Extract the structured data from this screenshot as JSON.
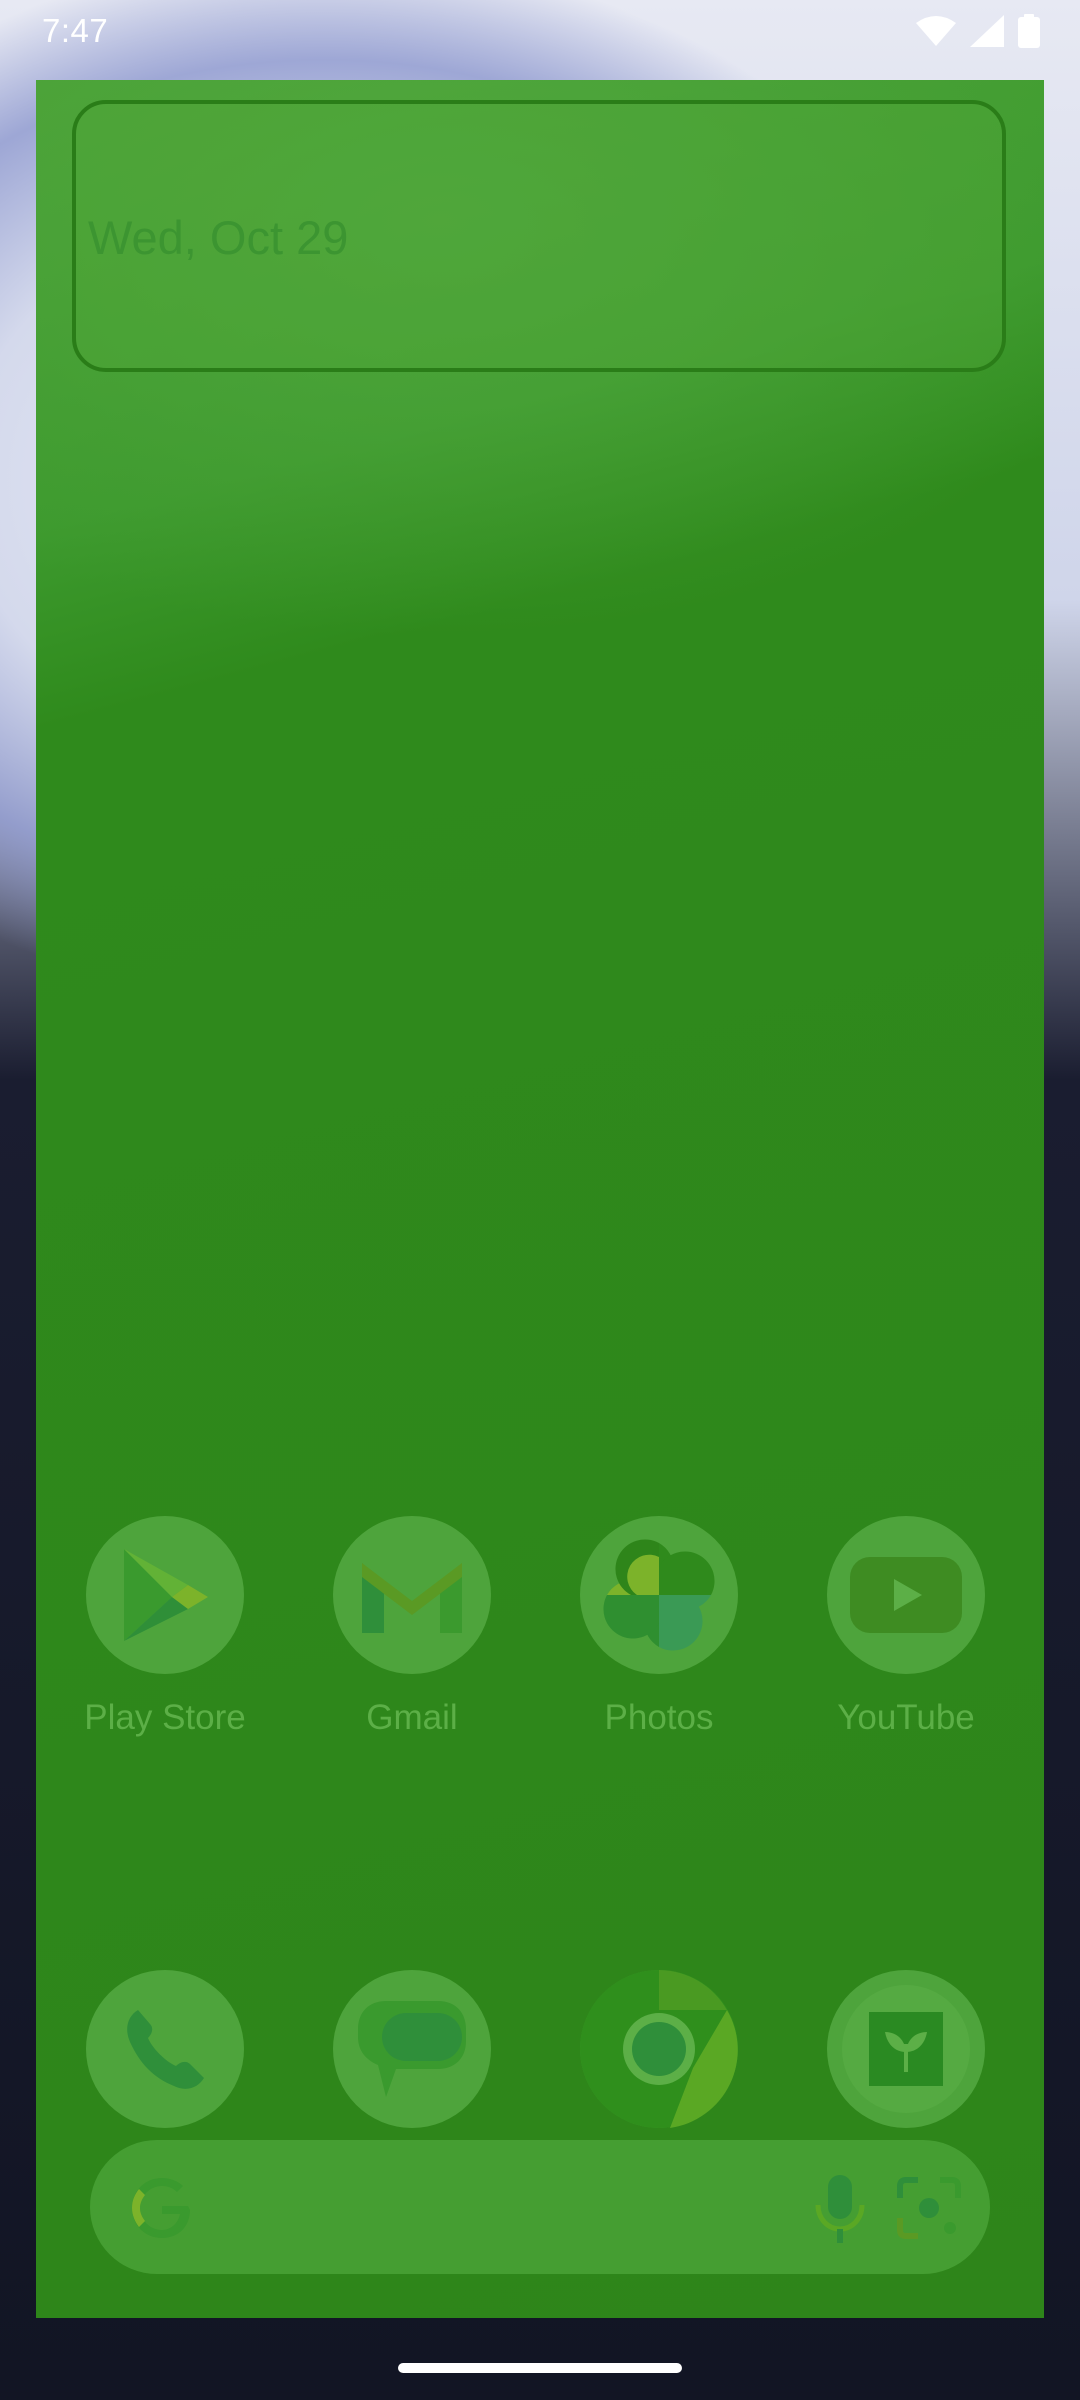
{
  "status_bar": {
    "time": "7:47",
    "icons": [
      "wifi-icon",
      "cellular-signal-icon",
      "battery-icon"
    ]
  },
  "home": {
    "date_widget": {
      "date": "Wed, Oct 29"
    },
    "apps_row1": [
      {
        "label": "Play Store",
        "icon": "play-store-icon"
      },
      {
        "label": "Gmail",
        "icon": "gmail-icon"
      },
      {
        "label": "Photos",
        "icon": "photos-icon"
      },
      {
        "label": "YouTube",
        "icon": "youtube-icon"
      }
    ],
    "dock": [
      {
        "icon": "phone-icon"
      },
      {
        "icon": "messages-icon"
      },
      {
        "icon": "chrome-icon"
      },
      {
        "icon": "app-plant-icon"
      }
    ],
    "search_bar": {
      "icons": [
        "google-g-icon",
        "mic-icon",
        "lens-icon"
      ]
    }
  },
  "colors": {
    "overlay_green": "#2e851a",
    "icon_bg": "#4ea43c",
    "label": "#5caf47"
  }
}
